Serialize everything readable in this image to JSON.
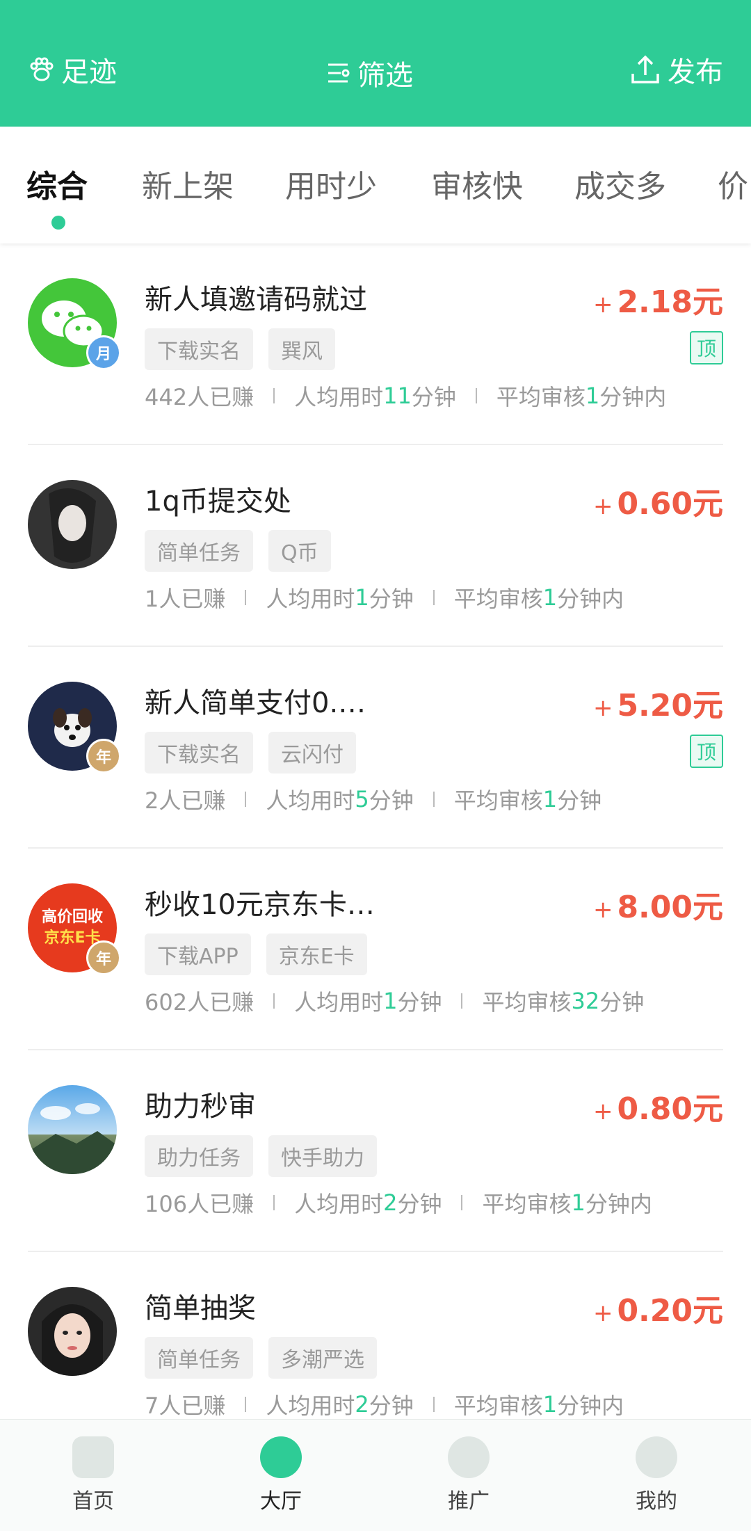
{
  "header": {
    "left_label": "足迹",
    "center_label": "筛选",
    "right_label": "发布"
  },
  "tabs": [
    {
      "label": "综合",
      "active": true
    },
    {
      "label": "新上架"
    },
    {
      "label": "用时少"
    },
    {
      "label": "审核快"
    },
    {
      "label": "成交多"
    },
    {
      "label": "价"
    }
  ],
  "tasks": [
    {
      "title": "新人填邀请码就过",
      "plus": "+",
      "price": "2.18元",
      "tags": [
        "下载实名",
        "巽风"
      ],
      "top": "顶",
      "medal": "月",
      "earned": "442人已赚",
      "avg_prefix": "人均用时",
      "avg_num": "11",
      "avg_suffix": "分钟",
      "review_prefix": "平均审核",
      "review_num": "1",
      "review_suffix": "分钟内"
    },
    {
      "title": "1q币提交处",
      "plus": "+",
      "price": "0.60元",
      "tags": [
        "简单任务",
        "Q币"
      ],
      "earned": "1人已赚",
      "avg_prefix": "人均用时",
      "avg_num": "1",
      "avg_suffix": "分钟",
      "review_prefix": "平均审核",
      "review_num": "1",
      "review_suffix": "分钟内"
    },
    {
      "title": "新人简单支付0.…",
      "plus": "+",
      "price": "5.20元",
      "tags": [
        "下载实名",
        "云闪付"
      ],
      "top": "顶",
      "medal": "年",
      "earned": "2人已赚",
      "avg_prefix": "人均用时",
      "avg_num": "5",
      "avg_suffix": "分钟",
      "review_prefix": "平均审核",
      "review_num": "1",
      "review_suffix": "分钟"
    },
    {
      "title": "秒收10元京东卡…",
      "plus": "+",
      "price": "8.00元",
      "tags": [
        "下载APP",
        "京东E卡"
      ],
      "medal": "年",
      "avatar_text_1": "高价回收",
      "avatar_text_2": "京东E卡",
      "earned": "602人已赚",
      "avg_prefix": "人均用时",
      "avg_num": "1",
      "avg_suffix": "分钟",
      "review_prefix": "平均审核",
      "review_num": "32",
      "review_suffix": "分钟"
    },
    {
      "title": "助力秒审",
      "plus": "+",
      "price": "0.80元",
      "tags": [
        "助力任务",
        "快手助力"
      ],
      "earned": "106人已赚",
      "avg_prefix": "人均用时",
      "avg_num": "2",
      "avg_suffix": "分钟",
      "review_prefix": "平均审核",
      "review_num": "1",
      "review_suffix": "分钟内"
    },
    {
      "title": "简单抽奖",
      "plus": "+",
      "price": "0.20元",
      "tags": [
        "简单任务",
        "多潮严选"
      ],
      "earned": "7人已赚",
      "avg_prefix": "人均用时",
      "avg_num": "2",
      "avg_suffix": "分钟",
      "review_prefix": "平均审核",
      "review_num": "1",
      "review_suffix": "分钟内"
    }
  ],
  "bottom_nav": [
    {
      "label": "首页"
    },
    {
      "label": "大厅",
      "active": true
    },
    {
      "label": "推广"
    },
    {
      "label": "我的"
    }
  ],
  "colors": {
    "brand": "#2ECC96",
    "price": "#EE5B45"
  }
}
